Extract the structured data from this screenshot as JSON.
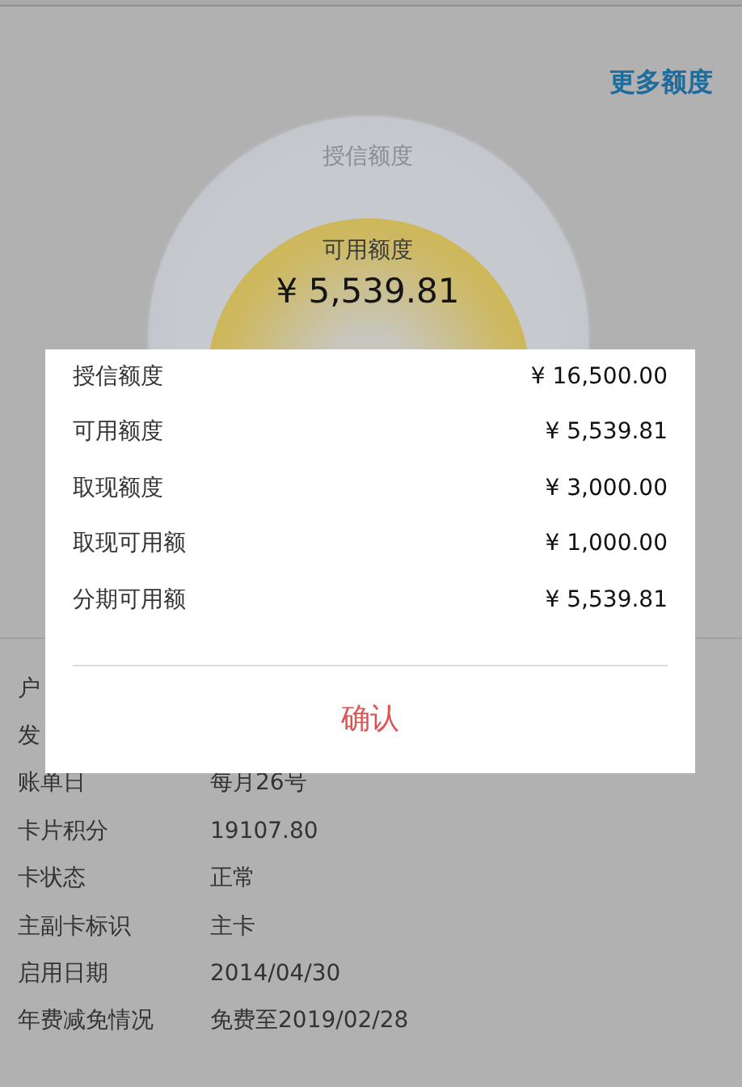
{
  "header": {
    "link": "更多额度"
  },
  "gauge": {
    "outer_label": "授信额度",
    "inner_label": "可用额度",
    "inner_value": "¥ 5,539.81"
  },
  "details": [
    {
      "label": "户"
    },
    {
      "label": "发"
    },
    {
      "label": "账单日",
      "value": "每月26号"
    },
    {
      "label": "卡片积分",
      "value": "19107.80"
    },
    {
      "label": "卡状态",
      "value": "正常"
    },
    {
      "label": "主副卡标识",
      "value": "主卡"
    },
    {
      "label": "启用日期",
      "value": "2014/04/30"
    },
    {
      "label": "年费减免情况",
      "value": "免费至2019/02/28"
    }
  ],
  "dialog": {
    "rows": [
      {
        "label": "授信额度",
        "value": "¥ 16,500.00"
      },
      {
        "label": "可用额度",
        "value": "¥ 5,539.81"
      },
      {
        "label": "取现额度",
        "value": "¥ 3,000.00"
      },
      {
        "label": "取现可用额",
        "value": "¥ 1,000.00"
      },
      {
        "label": "分期可用额",
        "value": "¥ 5,539.81"
      }
    ],
    "button": "确认"
  }
}
